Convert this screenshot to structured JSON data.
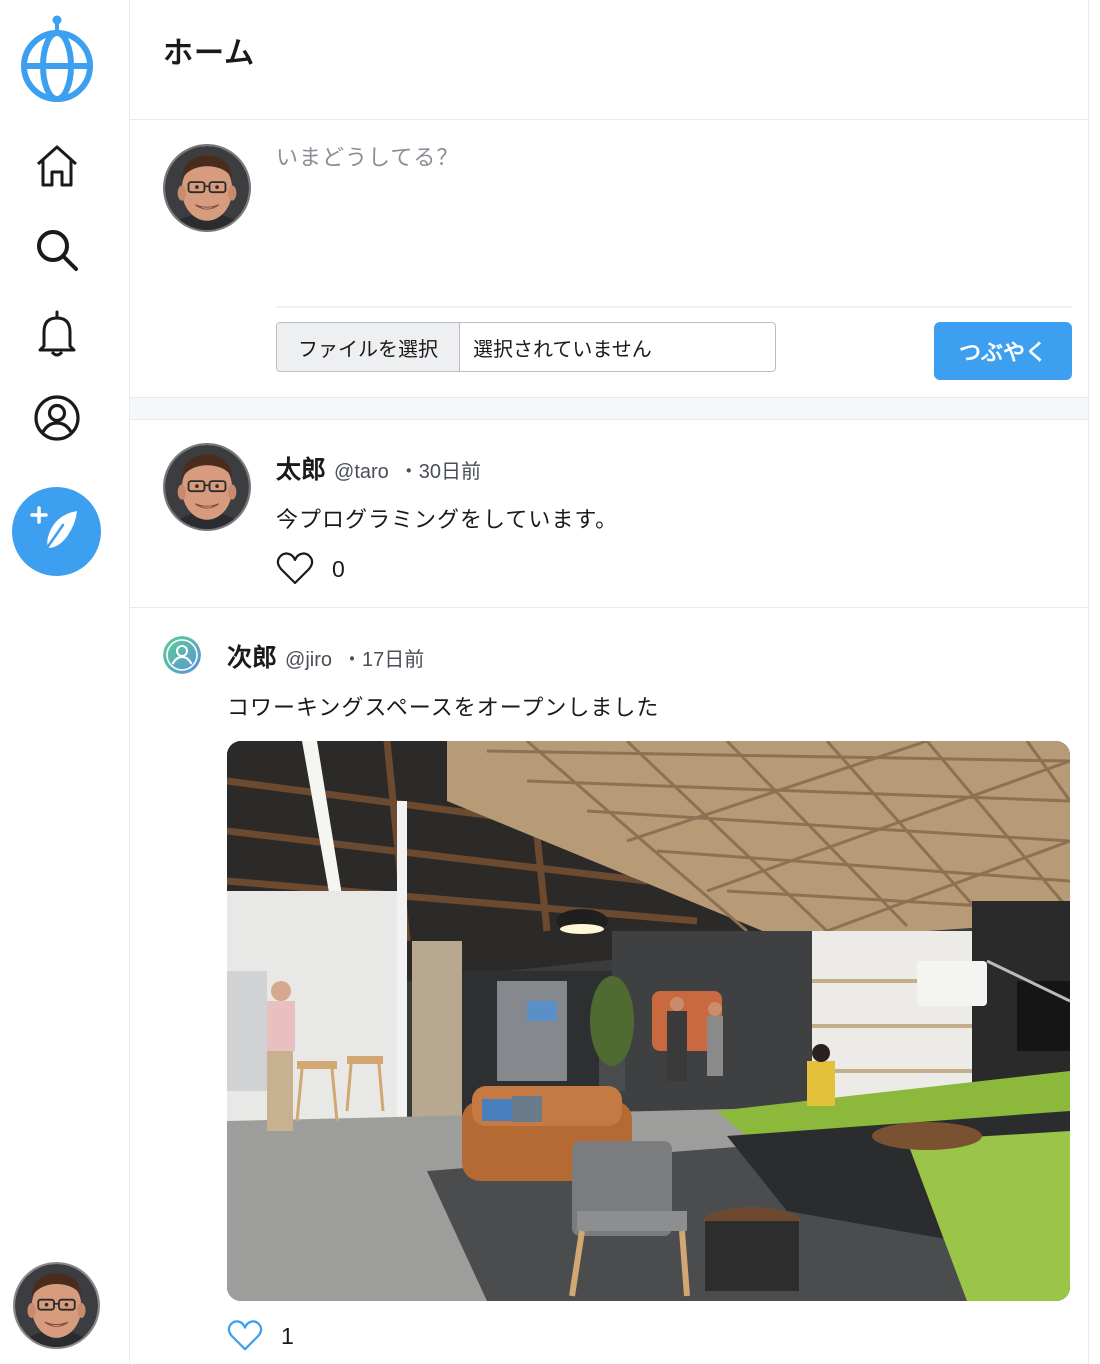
{
  "sidebar": {
    "logo_icon": "globe-logo-icon",
    "nav": [
      {
        "icon": "home-icon"
      },
      {
        "icon": "search-icon"
      },
      {
        "icon": "bell-icon"
      },
      {
        "icon": "profile-icon"
      }
    ],
    "compose_icon": "feather-plus-icon",
    "accent": "#3c9ff0"
  },
  "header": {
    "title": "ホーム"
  },
  "composer": {
    "placeholder": "いまどうしてる？",
    "file_button": "ファイルを選択",
    "file_status": "選択されていません",
    "submit_label": "つぶやく"
  },
  "posts": [
    {
      "name": "太郎",
      "handle": "@taro",
      "time": "・30日前",
      "text": "今プログラミングをしています。",
      "likes": "0",
      "liked": false
    },
    {
      "name": "次郎",
      "handle": "@jiro",
      "time": "・17日前",
      "text": "コワーキングスペースをオープンしました",
      "likes": "1",
      "liked": false,
      "has_image": true
    }
  ]
}
